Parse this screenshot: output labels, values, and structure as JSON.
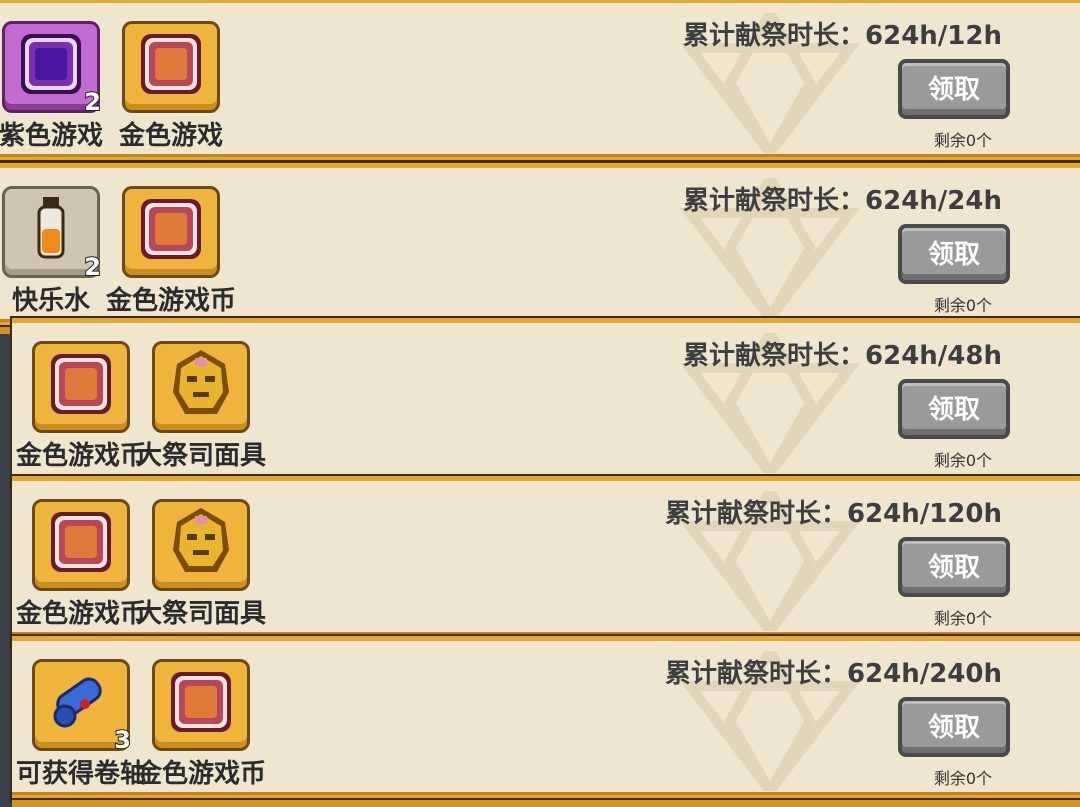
{
  "rewards": [
    {
      "progress": "累计献祭时长：624h/12h",
      "button": "领取",
      "remaining": "剩余0个",
      "items": [
        {
          "label": "紫色游戏",
          "count": "2",
          "icon": "purple-coin-icon"
        },
        {
          "label": "金色游戏",
          "count": "",
          "icon": "gold-coin-icon"
        }
      ]
    },
    {
      "progress": "累计献祭时长：624h/24h",
      "button": "领取",
      "remaining": "剩余0个",
      "items": [
        {
          "label": "快乐水",
          "count": "2",
          "icon": "happy-water-bottle-icon"
        },
        {
          "label": "金色游戏币",
          "count": "",
          "icon": "gold-coin-icon"
        }
      ]
    },
    {
      "progress": "累计献祭时长：624h/48h",
      "button": "领取",
      "remaining": "剩余0个",
      "items": [
        {
          "label": "金色游戏币",
          "count": "",
          "icon": "gold-coin-icon"
        },
        {
          "label": "大祭司面具",
          "count": "",
          "icon": "priest-mask-icon"
        }
      ]
    },
    {
      "progress": "累计献祭时长：624h/120h",
      "button": "领取",
      "remaining": "剩余0个",
      "items": [
        {
          "label": "金色游戏币",
          "count": "",
          "icon": "gold-coin-icon"
        },
        {
          "label": "大祭司面具",
          "count": "",
          "icon": "priest-mask-icon"
        }
      ]
    },
    {
      "progress": "累计献祭时长：624h/240h",
      "button": "领取",
      "remaining": "剩余0个",
      "items": [
        {
          "label": "可获得卷轴",
          "count": "3",
          "icon": "scroll-icon"
        },
        {
          "label": "金色游戏币",
          "count": "",
          "icon": "gold-coin-icon"
        }
      ]
    }
  ]
}
